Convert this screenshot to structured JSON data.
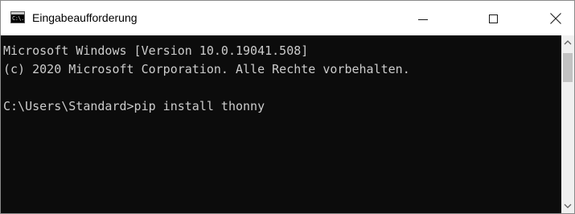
{
  "window": {
    "title": "Eingabeaufforderung",
    "icon": "cmd-icon",
    "icon_text": "C:\\."
  },
  "caption_buttons": {
    "minimize": "minimize-icon",
    "maximize": "maximize-icon",
    "close": "close-icon"
  },
  "console": {
    "lines": [
      "Microsoft Windows [Version 10.0.19041.508]",
      "(c) 2020 Microsoft Corporation. Alle Rechte vorbehalten.",
      "C:\\Users\\Standard>pip install thonny"
    ],
    "text_color": "#cccccc",
    "background_color": "#0c0c0c"
  },
  "scrollbar": {
    "up": "chevron-up-icon",
    "down": "chevron-down-icon"
  }
}
